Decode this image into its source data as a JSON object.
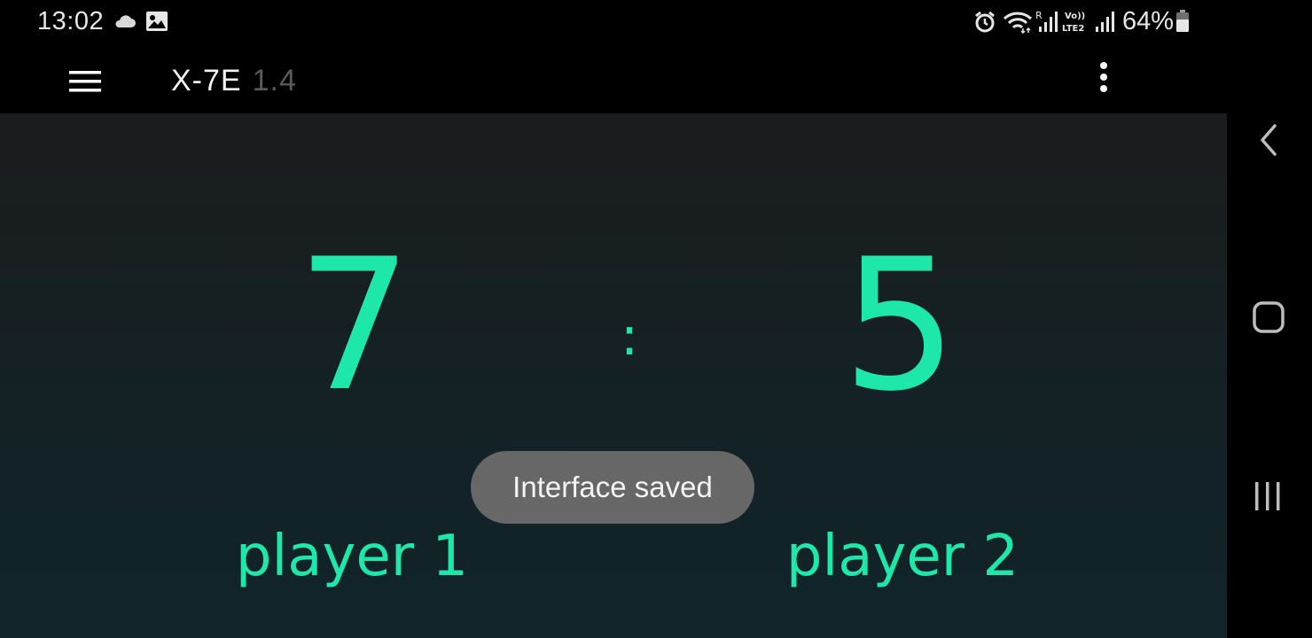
{
  "status_bar": {
    "time": "13:02",
    "battery_percent": "64%",
    "battery_level": 0.64,
    "icons": [
      "cloud-icon",
      "image-icon",
      "alarm-icon",
      "wifi-icon",
      "signal-roaming-icon",
      "volte-lte2-icon",
      "signal-icon",
      "battery-icon"
    ]
  },
  "app_bar": {
    "title": "X-7E",
    "version": "1.4",
    "menu_icon": "hamburger-menu-icon",
    "overflow_icon": "more-vertical-icon"
  },
  "scoreboard": {
    "player1_score": "7",
    "separator": ":",
    "player2_score": "5",
    "player1_label": "player 1",
    "player2_label": "player 2",
    "accent_color": "#1ee8a9"
  },
  "toast": {
    "message": "Interface saved"
  },
  "nav_bar": {
    "back_icon": "back-chevron-icon",
    "home_icon": "home-icon",
    "recents_icon": "recents-icon"
  }
}
